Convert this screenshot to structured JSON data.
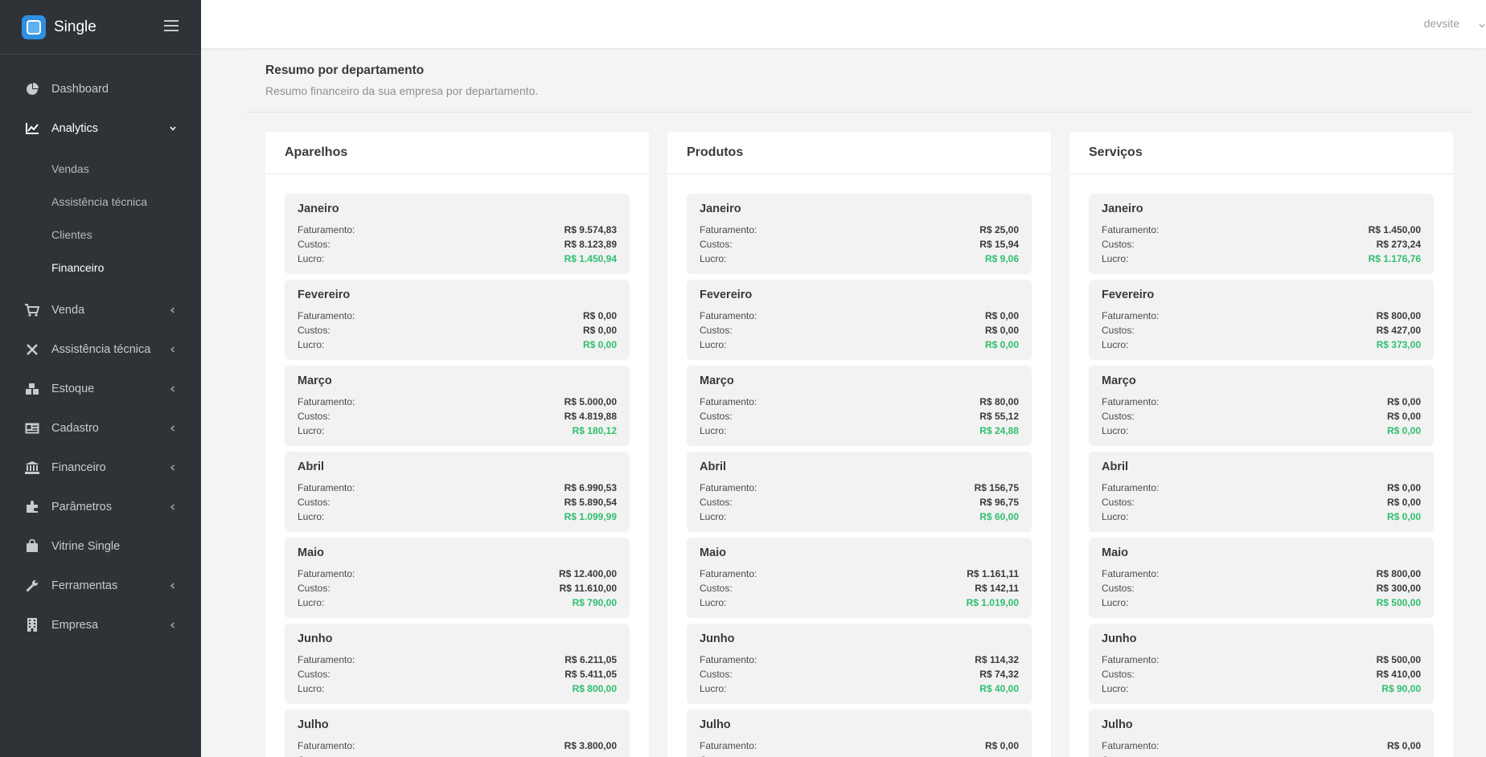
{
  "brand": {
    "name": "Single",
    "accent": "#2f8fe0"
  },
  "topbar": {
    "user": "devsite"
  },
  "sidebar": {
    "items": [
      {
        "label": "Dashboard",
        "icon": "pie-chart-icon",
        "arrow": false
      },
      {
        "label": "Analytics",
        "icon": "line-chart-icon",
        "arrow": "down",
        "sub": [
          "Vendas",
          "Assistência técnica",
          "Clientes",
          "Financeiro"
        ]
      },
      {
        "label": "Venda",
        "icon": "cart-icon",
        "arrow": "left"
      },
      {
        "label": "Assistência técnica",
        "icon": "tools-icon",
        "arrow": "left"
      },
      {
        "label": "Estoque",
        "icon": "boxes-icon",
        "arrow": "left"
      },
      {
        "label": "Cadastro",
        "icon": "id-card-icon",
        "arrow": "left"
      },
      {
        "label": "Financeiro",
        "icon": "bank-icon",
        "arrow": "left"
      },
      {
        "label": "Parâmetros",
        "icon": "puzzle-icon",
        "arrow": "left"
      },
      {
        "label": "Vitrine Single",
        "icon": "shopping-bag-icon",
        "arrow": false
      },
      {
        "label": "Ferramentas",
        "icon": "wrench-icon",
        "arrow": "left"
      },
      {
        "label": "Empresa",
        "icon": "building-icon",
        "arrow": "left"
      }
    ]
  },
  "panel": {
    "title": "Resumo por departamento",
    "subtitle": "Resumo financeiro da sua empresa por departamento."
  },
  "labels": {
    "revenue": "Faturamento:",
    "costs": "Custos:",
    "profit": "Lucro:"
  },
  "colors": {
    "profit": "#2fbf6f",
    "sidebar": "#2f3237"
  },
  "departments": [
    {
      "name": "Aparelhos",
      "months": [
        {
          "month": "Janeiro",
          "revenue": "R$ 9.574,83",
          "costs": "R$ 8.123,89",
          "profit": "R$ 1.450,94"
        },
        {
          "month": "Fevereiro",
          "revenue": "R$ 0,00",
          "costs": "R$ 0,00",
          "profit": "R$ 0,00"
        },
        {
          "month": "Março",
          "revenue": "R$ 5.000,00",
          "costs": "R$ 4.819,88",
          "profit": "R$ 180,12"
        },
        {
          "month": "Abril",
          "revenue": "R$ 6.990,53",
          "costs": "R$ 5.890,54",
          "profit": "R$ 1.099,99"
        },
        {
          "month": "Maio",
          "revenue": "R$ 12.400,00",
          "costs": "R$ 11.610,00",
          "profit": "R$ 790,00"
        },
        {
          "month": "Junho",
          "revenue": "R$ 6.211,05",
          "costs": "R$ 5.411,05",
          "profit": "R$ 800,00"
        },
        {
          "month": "Julho",
          "revenue": "R$ 3.800,00",
          "costs": "",
          "profit": ""
        }
      ]
    },
    {
      "name": "Produtos",
      "months": [
        {
          "month": "Janeiro",
          "revenue": "R$ 25,00",
          "costs": "R$ 15,94",
          "profit": "R$ 9,06"
        },
        {
          "month": "Fevereiro",
          "revenue": "R$ 0,00",
          "costs": "R$ 0,00",
          "profit": "R$ 0,00"
        },
        {
          "month": "Março",
          "revenue": "R$ 80,00",
          "costs": "R$ 55,12",
          "profit": "R$ 24,88"
        },
        {
          "month": "Abril",
          "revenue": "R$ 156,75",
          "costs": "R$ 96,75",
          "profit": "R$ 60,00"
        },
        {
          "month": "Maio",
          "revenue": "R$ 1.161,11",
          "costs": "R$ 142,11",
          "profit": "R$ 1.019,00"
        },
        {
          "month": "Junho",
          "revenue": "R$ 114,32",
          "costs": "R$ 74,32",
          "profit": "R$ 40,00"
        },
        {
          "month": "Julho",
          "revenue": "R$ 0,00",
          "costs": "",
          "profit": ""
        }
      ]
    },
    {
      "name": "Serviços",
      "months": [
        {
          "month": "Janeiro",
          "revenue": "R$ 1.450,00",
          "costs": "R$ 273,24",
          "profit": "R$ 1.176,76"
        },
        {
          "month": "Fevereiro",
          "revenue": "R$ 800,00",
          "costs": "R$ 427,00",
          "profit": "R$ 373,00"
        },
        {
          "month": "Março",
          "revenue": "R$ 0,00",
          "costs": "R$ 0,00",
          "profit": "R$ 0,00"
        },
        {
          "month": "Abril",
          "revenue": "R$ 0,00",
          "costs": "R$ 0,00",
          "profit": "R$ 0,00"
        },
        {
          "month": "Maio",
          "revenue": "R$ 800,00",
          "costs": "R$ 300,00",
          "profit": "R$ 500,00"
        },
        {
          "month": "Junho",
          "revenue": "R$ 500,00",
          "costs": "R$ 410,00",
          "profit": "R$ 90,00"
        },
        {
          "month": "Julho",
          "revenue": "R$ 0,00",
          "costs": "",
          "profit": ""
        }
      ]
    }
  ]
}
